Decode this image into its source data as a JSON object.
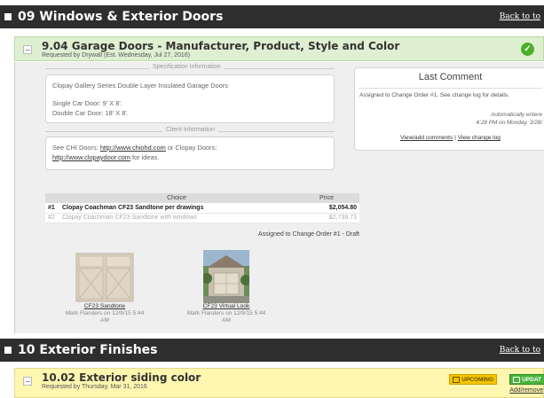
{
  "section_09": {
    "title": "09 Windows & Exterior Doors",
    "back_link": "Back to to"
  },
  "item_904": {
    "title": "9.04 Garage Doors - Manufacturer, Product, Style and Color",
    "requested": "Requested by Drywall (Est. Wednesday, Jul 27, 2016)",
    "status_icon": "check-circle-icon",
    "spec_legend": "Specification Information",
    "spec_line1": "Clopay Gallery Series Double Layer Insulated Garage Doors",
    "spec_line2": "Single Car Door: 9' X 8'.",
    "spec_line3": "Double Car Door: 18' X 8'.",
    "client_legend": "Client Information",
    "client_pre": "See CHI Doors: ",
    "client_link1": "http://www.chiohd.com",
    "client_mid": " or Clopay Doors:",
    "client_link2": "http://www.clopaydoor.com",
    "client_post": " for ideas.",
    "comment": {
      "title": "Last Comment",
      "text": "Assigned to Change Order #1. See change log for details.",
      "auto": "Automatically entere",
      "date": "4:28 PM on Monday, 3/28/",
      "link1": "View/add comments",
      "sep": " | ",
      "link2": "View change log"
    },
    "table": {
      "col_choice": "Choice",
      "col_price": "Price",
      "rows": [
        {
          "num": "#1",
          "choice": "Clopay Coachman CF23 Sandtone per drawings",
          "price": "$2,054.80"
        },
        {
          "num": "#2",
          "choice": "Clopay Coachman CF23 Sandtone with windows",
          "price": "$2,739.73"
        }
      ],
      "assigned": "Assigned to Change Order #1 - Draft"
    },
    "thumbs": [
      {
        "caption": "CF23 Sandtone",
        "meta": "Mark Flanders on 12/9/15 5:44 AM"
      },
      {
        "caption": "CF23 Virtual Look",
        "meta": "Mark Flanders on 12/9/15 5:44 AM"
      }
    ]
  },
  "section_10": {
    "title": "10 Exterior Finishes",
    "back_link": "Back to to"
  },
  "item_1002": {
    "title": "10.02 Exterior siding color",
    "requested": "Requested by Thursday, Mar 31, 2016",
    "badge_upcoming": "UPCOMING",
    "badge_update": "UPDAT",
    "add_remove": "Add/remove"
  },
  "colors": {
    "section_bar": "#2e2e2e",
    "complete_header": "#dff0d2",
    "upcoming_header": "#fff6b0",
    "check_green": "#4caf2a",
    "badge_yellow": "#f5c400",
    "badge_green": "#49b33c"
  }
}
